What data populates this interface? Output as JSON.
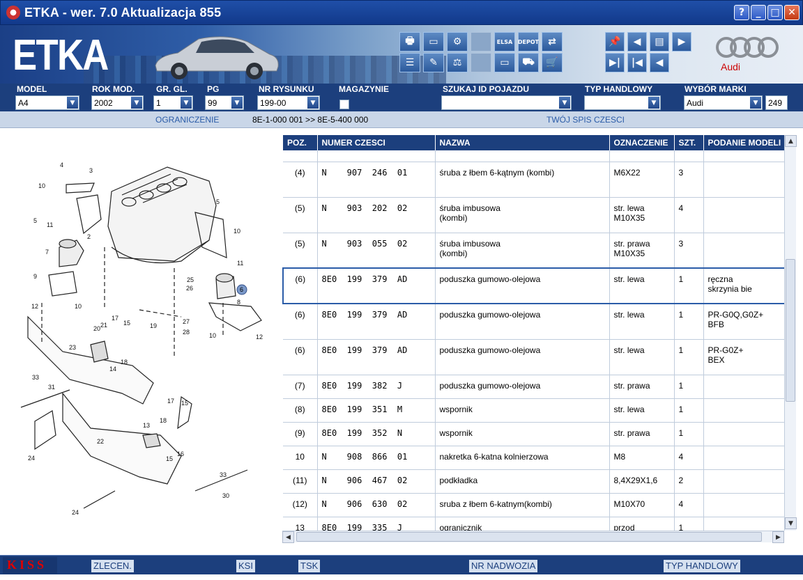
{
  "window": {
    "title": "ETKA - wer. 7.0 Aktualizacja 855",
    "buttons": [
      "?",
      "_",
      "□",
      "✕"
    ]
  },
  "banner": {
    "logo_text": "ETKA",
    "brand_label": "Audi",
    "tools": [
      {
        "icon": "printer-icon",
        "glyph": "🖶"
      },
      {
        "icon": "window-icon",
        "glyph": "▭"
      },
      {
        "icon": "parts-icon",
        "glyph": "⚙"
      },
      {
        "icon": "disabled-icon",
        "glyph": ""
      },
      {
        "icon": "elsa-icon",
        "glyph": "ELSA"
      },
      {
        "icon": "depot-icon",
        "glyph": "DEPOT"
      },
      {
        "icon": "cart-transfer-icon",
        "glyph": "⇄"
      },
      {
        "icon": "list-icon",
        "glyph": "☰"
      },
      {
        "icon": "edit-icon",
        "glyph": "✎"
      },
      {
        "icon": "scale-icon",
        "glyph": "⚖"
      },
      {
        "icon": "disabled-icon",
        "glyph": ""
      },
      {
        "icon": "devices-icon",
        "glyph": "▭"
      },
      {
        "icon": "vehicle-icon",
        "glyph": "⛟"
      },
      {
        "icon": "cart-icon",
        "glyph": "🛒"
      }
    ],
    "nav": [
      {
        "icon": "pin-icon",
        "glyph": "📌"
      },
      {
        "icon": "prev-page-icon",
        "glyph": "◀"
      },
      {
        "icon": "page-icon",
        "glyph": "▤"
      },
      {
        "icon": "next-page-icon",
        "glyph": "▶"
      },
      {
        "icon": "last-icon",
        "glyph": "▶|"
      },
      {
        "icon": "first-icon",
        "glyph": "|◀"
      },
      {
        "icon": "back-icon",
        "glyph": "◀"
      }
    ]
  },
  "filters": {
    "model": {
      "label": "MODEL",
      "value": "A4"
    },
    "rok_mod": {
      "label": "ROK MOD.",
      "value": "2002"
    },
    "gr_gl": {
      "label": "GR. GL.",
      "value": "1"
    },
    "pg": {
      "label": "PG",
      "value": "99"
    },
    "nr_rysunku": {
      "label": "NR RYSUNKU",
      "value": "199-00"
    },
    "magazynie": {
      "label": "MAGAZYNIE"
    },
    "szukaj": {
      "label": "SZUKAJ ID POJAZDU",
      "value": ""
    },
    "typ_handlowy": {
      "label": "TYP HANDLOWY",
      "value": ""
    },
    "wybor_marki": {
      "label": "WYBÓR MARKI",
      "value": "Audi"
    },
    "count": "249"
  },
  "infobar": {
    "ograniczenie_label": "OGRANICZENIE",
    "ograniczenie_value": "8E-1-000 001 >> 8E-5-400 000",
    "spis_label": "TWÓJ SPIS CZESCI"
  },
  "table": {
    "headers": [
      "POZ.",
      "NUMER CZESCI",
      "NAZWA",
      "OZNACZENIE",
      "SZT.",
      "PODANIE MODELI"
    ],
    "rows": [
      {
        "poz": "(4)",
        "numer": "N    907  246  01",
        "nazwa": "śruba z łbem 6-kątnym (kombi)",
        "oznaczenie": "M6X22",
        "szt": "3",
        "podanie": ""
      },
      {
        "poz": "(5)",
        "numer": "N    903  202  02",
        "nazwa": "śruba imbusowa\n(kombi)",
        "oznaczenie": "str. lewa\nM10X35",
        "szt": "4",
        "podanie": ""
      },
      {
        "poz": "(5)",
        "numer": "N    903  055  02",
        "nazwa": "śruba imbusowa\n(kombi)",
        "oznaczenie": "str. prawa\nM10X35",
        "szt": "3",
        "podanie": ""
      },
      {
        "poz": "(6)",
        "numer": "8E0  199  379  AD",
        "nazwa": "poduszka gumowo-olejowa",
        "oznaczenie": "str. lewa",
        "szt": "1",
        "podanie": "ręczna\nskrzynia bie"
      },
      {
        "poz": "(6)",
        "numer": "8E0  199  379  AD",
        "nazwa": "poduszka gumowo-olejowa",
        "oznaczenie": "str. lewa",
        "szt": "1",
        "podanie": "PR-G0Q,G0Z+\nBFB"
      },
      {
        "poz": "(6)",
        "numer": "8E0  199  379  AD",
        "nazwa": "poduszka gumowo-olejowa",
        "oznaczenie": "str. lewa",
        "szt": "1",
        "podanie": "PR-G0Z+\nBEX"
      },
      {
        "poz": "(7)",
        "numer": "8E0  199  382  J",
        "nazwa": "poduszka gumowo-olejowa",
        "oznaczenie": "str. prawa",
        "szt": "1",
        "podanie": ""
      },
      {
        "poz": "(8)",
        "numer": "8E0  199  351  M",
        "nazwa": "wspornik",
        "oznaczenie": "str. lewa",
        "szt": "1",
        "podanie": ""
      },
      {
        "poz": "(9)",
        "numer": "8E0  199  352  N",
        "nazwa": "wspornik",
        "oznaczenie": "str. prawa",
        "szt": "1",
        "podanie": ""
      },
      {
        "poz": "10",
        "numer": "N    908  866  01",
        "nazwa": "nakretka 6-katna kolnierzowa",
        "oznaczenie": "M8",
        "szt": "4",
        "podanie": ""
      },
      {
        "poz": "(11)",
        "numer": "N    906  467  02",
        "nazwa": "podkładka",
        "oznaczenie": "8,4X29X1,6",
        "szt": "2",
        "podanie": ""
      },
      {
        "poz": "(12)",
        "numer": "N    906  630  02",
        "nazwa": "sruba z łbem 6-katnym(kombi)",
        "oznaczenie": "M10X70",
        "szt": "4",
        "podanie": ""
      },
      {
        "poz": "13",
        "numer": "8E0  199  335  J",
        "nazwa": "ogranicznik",
        "oznaczenie": "przod",
        "szt": "1",
        "podanie": ""
      }
    ]
  },
  "drawing": {
    "callouts": [
      "4",
      "3",
      "10",
      "5",
      "2",
      "11",
      "7",
      "9",
      "12",
      "10",
      "5",
      "10",
      "11",
      "25",
      "26",
      "6",
      "8",
      "17",
      "15",
      "19",
      "20",
      "21",
      "27",
      "28",
      "10",
      "12",
      "23",
      "18",
      "14",
      "33",
      "31",
      "17",
      "15",
      "24",
      "13",
      "18",
      "22",
      "15",
      "16",
      "33",
      "30",
      "24"
    ]
  },
  "statusbar": {
    "kiss": "KISS",
    "items": [
      "ZLECEN.",
      "KSI",
      "TSK",
      "NR NADWOZIA",
      "TYP HANDLOWY"
    ]
  },
  "colors": {
    "accent": "#1c3f7d",
    "title": "#12398a",
    "selection": "#2b5ca8"
  }
}
